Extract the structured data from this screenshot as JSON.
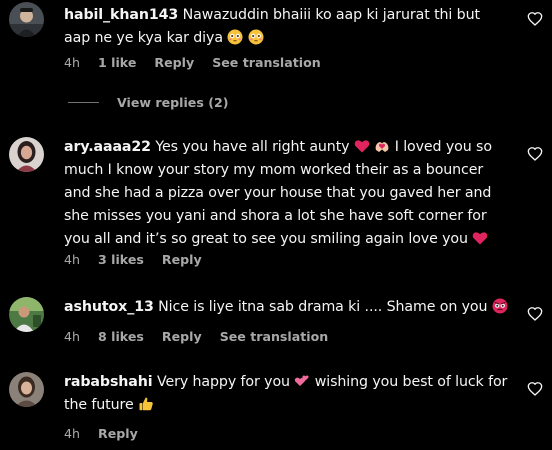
{
  "comments": [
    {
      "username": "habil_khan143",
      "text": "Nawazuddin bhaiii ko aap ki jarurat thi but aap ne ye kya kar diya",
      "time": "4h",
      "likes": "1 like",
      "reply": "Reply",
      "see_translation": "See translation",
      "view_replies": "View replies (2)",
      "emojis": [
        "flushed-face",
        "flushed-face"
      ]
    },
    {
      "username": "ary.aaaa22",
      "text_1": "Yes you have all right aunty",
      "text_2": "I loved you so much I know your story my mom worked their as a bouncer and she had a pizza over your house that you gaved her and she misses you yani and shora a lot she have soft corner for you all and it’s so great to see you smiling again love you",
      "time": "4h",
      "likes": "3 likes",
      "reply": "Reply",
      "emojis": [
        "red-heart",
        "heart-hands",
        "red-heart"
      ]
    },
    {
      "username": "ashutox_13",
      "text": "Nice is liye itna sab drama ki .... Shame on you",
      "time": "4h",
      "likes": "8 likes",
      "reply": "Reply",
      "see_translation": "See translation",
      "emojis": [
        "angry-face"
      ]
    },
    {
      "username": "rababshahi",
      "text_1": "Very happy for you",
      "text_2": "wishing you best of luck for the future",
      "time": "4h",
      "reply": "Reply",
      "emojis": [
        "two-hearts",
        "thumbs-up"
      ]
    }
  ],
  "colors": {
    "background": "#000000",
    "text": "#f5f5f5",
    "secondary": "#a8a8a8",
    "heart_red": "#e0245e"
  }
}
